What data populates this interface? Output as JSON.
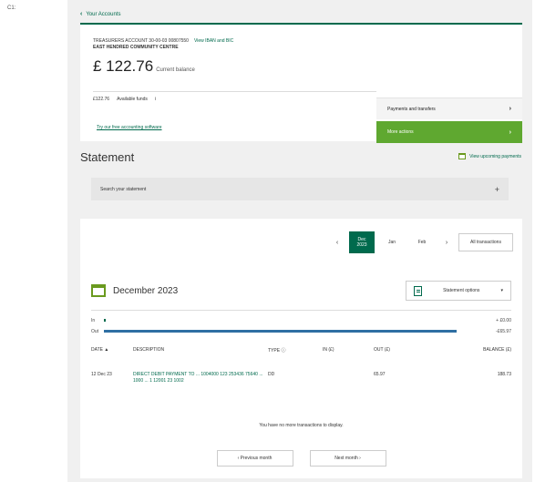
{
  "corner_label": "C1:",
  "nav": {
    "back_label": "Your Accounts",
    "back_icon": "chevron-left-icon"
  },
  "account": {
    "name_line": "TREASURERS ACCOUNT  30-00-03  00807550",
    "view_link": "View IBAN and BIC",
    "organisation": "EAST HENDRED COMMUNITY CENTRE",
    "balance": "£ 122.76",
    "balance_label": "Current balance",
    "available_amount": "£122.76",
    "available_label": "Available funds",
    "available_info": "i",
    "software_link": "Try our free accounting software"
  },
  "actions": {
    "payments": "Payments and transfers",
    "more": "More actions"
  },
  "statement": {
    "title": "Statement",
    "upcoming": "View upcoming payments",
    "search_label": "Search your statement",
    "search_toggle": "+"
  },
  "month_nav": {
    "prev": "‹",
    "active_month": "Dec",
    "active_year": "2023",
    "months": [
      "Jan",
      "Feb"
    ],
    "next": "›",
    "all": "All transactions"
  },
  "month_view": {
    "heading": "December 2023",
    "options": "Statement options",
    "options_caret": "▾",
    "in_label": "In",
    "in_amount": "+ £0.00",
    "in_fraction": 0.0,
    "out_label": "Out",
    "out_amount": "-£65.97",
    "out_fraction": 1.0
  },
  "table": {
    "headers": [
      "DATE ▲",
      "DESCRIPTION",
      "TYPE ⓘ",
      "IN (£)",
      "OUT (£)",
      "BALANCE (£)"
    ],
    "rows": [
      {
        "date": "12 Dec 23",
        "description": "DIRECT DEBIT PAYMENT TO ... 1004000 123 253436 75640 ... 1000 ... 1 12001 23 1002",
        "type": "DD",
        "in": "",
        "out": "65.97",
        "balance": "188.73"
      }
    ]
  },
  "footer": {
    "no_more": "You have no more transactions to display.",
    "prev_month": "‹ Previous month",
    "next_month": "Next month ›"
  },
  "colors": {
    "brand_green": "#006a4d",
    "action_green": "#5fa830",
    "bar_blue": "#2f6fa3"
  }
}
